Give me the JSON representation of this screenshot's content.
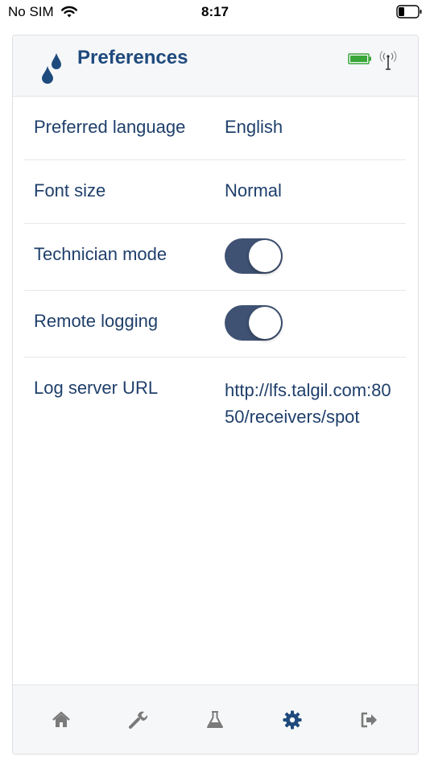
{
  "status_bar": {
    "carrier": "No SIM",
    "time": "8:17"
  },
  "header": {
    "title": "Preferences",
    "logo_icon": "water-drops-icon",
    "battery_icon": "battery-full-icon",
    "signal_icon": "antenna-signal-icon"
  },
  "preferences": {
    "language": {
      "label": "Preferred language",
      "value": "English"
    },
    "font_size": {
      "label": "Font size",
      "value": "Normal"
    },
    "technician_mode": {
      "label": "Technician mode",
      "enabled": true
    },
    "remote_logging": {
      "label": "Remote logging",
      "enabled": true
    },
    "log_server": {
      "label": "Log server URL",
      "value": "http://lfs.talgil.com:8050/receivers/spot"
    }
  },
  "bottom_nav": {
    "items": [
      {
        "icon": "home-icon",
        "active": false
      },
      {
        "icon": "wrench-icon",
        "active": false
      },
      {
        "icon": "flask-icon",
        "active": false
      },
      {
        "icon": "gear-icon",
        "active": true
      },
      {
        "icon": "sign-out-icon",
        "active": false
      }
    ]
  },
  "colors": {
    "primary_text": "#1f3f6b",
    "toggle_on": "#3f5273",
    "active_nav": "#1f4a7d",
    "inactive_nav": "#7a7a7a"
  }
}
